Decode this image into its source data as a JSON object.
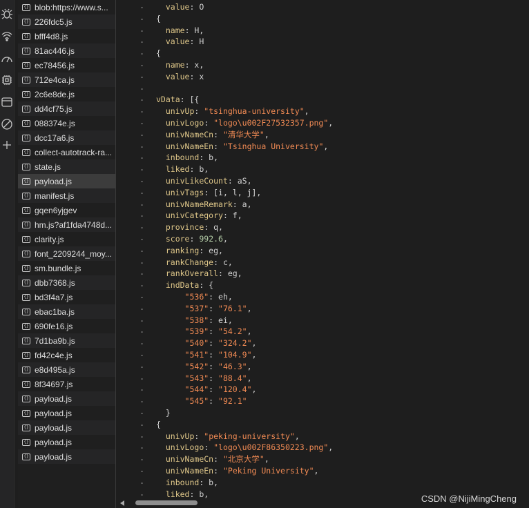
{
  "files": [
    "blob:https://www.s...",
    "226fdc5.js",
    "bfff4d8.js",
    "81ac446.js",
    "ec78456.js",
    "712e4ca.js",
    "2c6e8de.js",
    "dd4cf75.js",
    "088374e.js",
    "dcc17a6.js",
    "collect-autotrack-ra...",
    "state.js",
    "payload.js",
    "manifest.js",
    "gqen6yjgev",
    "hm.js?af1fda4748d...",
    "clarity.js",
    "font_2209244_moy...",
    "sm.bundle.js",
    "dbb7368.js",
    "bd3f4a7.js",
    "ebac1ba.js",
    "690fe16.js",
    "7d1ba9b.js",
    "fd42c4e.js",
    "e8d495a.js",
    "8f34697.js",
    "payload.js",
    "payload.js",
    "payload.js",
    "payload.js",
    "payload.js"
  ],
  "selected_file_index": 12,
  "file_icon_glyph": "{}",
  "gutter_mark": "-",
  "code_lines": [
    [
      [
        "p",
        "  "
      ],
      [
        "k",
        "value"
      ],
      [
        "p",
        ": O"
      ]
    ],
    [
      [
        "p",
        "{"
      ]
    ],
    [
      [
        "p",
        "  "
      ],
      [
        "k",
        "name"
      ],
      [
        "p",
        ": H,"
      ]
    ],
    [
      [
        "p",
        "  "
      ],
      [
        "k",
        "value"
      ],
      [
        "p",
        ": H"
      ]
    ],
    [
      [
        "p",
        "{"
      ]
    ],
    [
      [
        "p",
        "  "
      ],
      [
        "k",
        "name"
      ],
      [
        "p",
        ": x,"
      ]
    ],
    [
      [
        "p",
        "  "
      ],
      [
        "k",
        "value"
      ],
      [
        "p",
        ": x"
      ]
    ],
    [
      [
        "p",
        ""
      ]
    ],
    [
      [
        "k",
        "vData"
      ],
      [
        "p",
        ": [{"
      ]
    ],
    [
      [
        "p",
        "  "
      ],
      [
        "k",
        "univUp"
      ],
      [
        "p",
        ": "
      ],
      [
        "s",
        "\"tsinghua-university\""
      ],
      [
        "p",
        ","
      ]
    ],
    [
      [
        "p",
        "  "
      ],
      [
        "k",
        "univLogo"
      ],
      [
        "p",
        ": "
      ],
      [
        "s",
        "\"logo\\u002F27532357.png\""
      ],
      [
        "p",
        ","
      ]
    ],
    [
      [
        "p",
        "  "
      ],
      [
        "k",
        "univNameCn"
      ],
      [
        "p",
        ": "
      ],
      [
        "s",
        "\"清华大学\""
      ],
      [
        "p",
        ","
      ]
    ],
    [
      [
        "p",
        "  "
      ],
      [
        "k",
        "univNameEn"
      ],
      [
        "p",
        ": "
      ],
      [
        "s",
        "\"Tsinghua University\""
      ],
      [
        "p",
        ","
      ]
    ],
    [
      [
        "p",
        "  "
      ],
      [
        "k",
        "inbound"
      ],
      [
        "p",
        ": b,"
      ]
    ],
    [
      [
        "p",
        "  "
      ],
      [
        "k",
        "liked"
      ],
      [
        "p",
        ": b,"
      ]
    ],
    [
      [
        "p",
        "  "
      ],
      [
        "k",
        "univLikeCount"
      ],
      [
        "p",
        ": aS,"
      ]
    ],
    [
      [
        "p",
        "  "
      ],
      [
        "k",
        "univTags"
      ],
      [
        "p",
        ": [i, l, j],"
      ]
    ],
    [
      [
        "p",
        "  "
      ],
      [
        "k",
        "univNameRemark"
      ],
      [
        "p",
        ": a,"
      ]
    ],
    [
      [
        "p",
        "  "
      ],
      [
        "k",
        "univCategory"
      ],
      [
        "p",
        ": f,"
      ]
    ],
    [
      [
        "p",
        "  "
      ],
      [
        "k",
        "province"
      ],
      [
        "p",
        ": q,"
      ]
    ],
    [
      [
        "p",
        "  "
      ],
      [
        "k",
        "score"
      ],
      [
        "p",
        ": "
      ],
      [
        "n",
        "992.6"
      ],
      [
        "p",
        ","
      ]
    ],
    [
      [
        "p",
        "  "
      ],
      [
        "k",
        "ranking"
      ],
      [
        "p",
        ": eg,"
      ]
    ],
    [
      [
        "p",
        "  "
      ],
      [
        "k",
        "rankChange"
      ],
      [
        "p",
        ": c,"
      ]
    ],
    [
      [
        "p",
        "  "
      ],
      [
        "k",
        "rankOverall"
      ],
      [
        "p",
        ": eg,"
      ]
    ],
    [
      [
        "p",
        "  "
      ],
      [
        "k",
        "indData"
      ],
      [
        "p",
        ": {"
      ]
    ],
    [
      [
        "p",
        "      "
      ],
      [
        "s",
        "\"536\""
      ],
      [
        "p",
        ": eh,"
      ]
    ],
    [
      [
        "p",
        "      "
      ],
      [
        "s",
        "\"537\""
      ],
      [
        "p",
        ": "
      ],
      [
        "s",
        "\"76.1\""
      ],
      [
        "p",
        ","
      ]
    ],
    [
      [
        "p",
        "      "
      ],
      [
        "s",
        "\"538\""
      ],
      [
        "p",
        ": ei,"
      ]
    ],
    [
      [
        "p",
        "      "
      ],
      [
        "s",
        "\"539\""
      ],
      [
        "p",
        ": "
      ],
      [
        "s",
        "\"54.2\""
      ],
      [
        "p",
        ","
      ]
    ],
    [
      [
        "p",
        "      "
      ],
      [
        "s",
        "\"540\""
      ],
      [
        "p",
        ": "
      ],
      [
        "s",
        "\"324.2\""
      ],
      [
        "p",
        ","
      ]
    ],
    [
      [
        "p",
        "      "
      ],
      [
        "s",
        "\"541\""
      ],
      [
        "p",
        ": "
      ],
      [
        "s",
        "\"104.9\""
      ],
      [
        "p",
        ","
      ]
    ],
    [
      [
        "p",
        "      "
      ],
      [
        "s",
        "\"542\""
      ],
      [
        "p",
        ": "
      ],
      [
        "s",
        "\"46.3\""
      ],
      [
        "p",
        ","
      ]
    ],
    [
      [
        "p",
        "      "
      ],
      [
        "s",
        "\"543\""
      ],
      [
        "p",
        ": "
      ],
      [
        "s",
        "\"88.4\""
      ],
      [
        "p",
        ","
      ]
    ],
    [
      [
        "p",
        "      "
      ],
      [
        "s",
        "\"544\""
      ],
      [
        "p",
        ": "
      ],
      [
        "s",
        "\"120.4\""
      ],
      [
        "p",
        ","
      ]
    ],
    [
      [
        "p",
        "      "
      ],
      [
        "s",
        "\"545\""
      ],
      [
        "p",
        ": "
      ],
      [
        "s",
        "\"92.1\""
      ]
    ],
    [
      [
        "p",
        "  }"
      ]
    ],
    [
      [
        "p",
        "{"
      ]
    ],
    [
      [
        "p",
        "  "
      ],
      [
        "k",
        "univUp"
      ],
      [
        "p",
        ": "
      ],
      [
        "s",
        "\"peking-university\""
      ],
      [
        "p",
        ","
      ]
    ],
    [
      [
        "p",
        "  "
      ],
      [
        "k",
        "univLogo"
      ],
      [
        "p",
        ": "
      ],
      [
        "s",
        "\"logo\\u002F86350223.png\""
      ],
      [
        "p",
        ","
      ]
    ],
    [
      [
        "p",
        "  "
      ],
      [
        "k",
        "univNameCn"
      ],
      [
        "p",
        ": "
      ],
      [
        "s",
        "\"北京大学\""
      ],
      [
        "p",
        ","
      ]
    ],
    [
      [
        "p",
        "  "
      ],
      [
        "k",
        "univNameEn"
      ],
      [
        "p",
        ": "
      ],
      [
        "s",
        "\"Peking University\""
      ],
      [
        "p",
        ","
      ]
    ],
    [
      [
        "p",
        "  "
      ],
      [
        "k",
        "inbound"
      ],
      [
        "p",
        ": b,"
      ]
    ],
    [
      [
        "p",
        "  "
      ],
      [
        "k",
        "liked"
      ],
      [
        "p",
        ": b,"
      ]
    ]
  ],
  "watermark": "CSDN @NijiMingCheng",
  "colors": {
    "key": "#e0c88a",
    "string": "#f28b54",
    "number": "#b5cea8",
    "punct": "#d4d4d4",
    "background": "#1e1e1e"
  },
  "activity_icons": [
    "bug-icon",
    "wifi-icon",
    "gauge-icon",
    "chip-icon",
    "window-icon",
    "block-icon",
    "plus-icon"
  ]
}
